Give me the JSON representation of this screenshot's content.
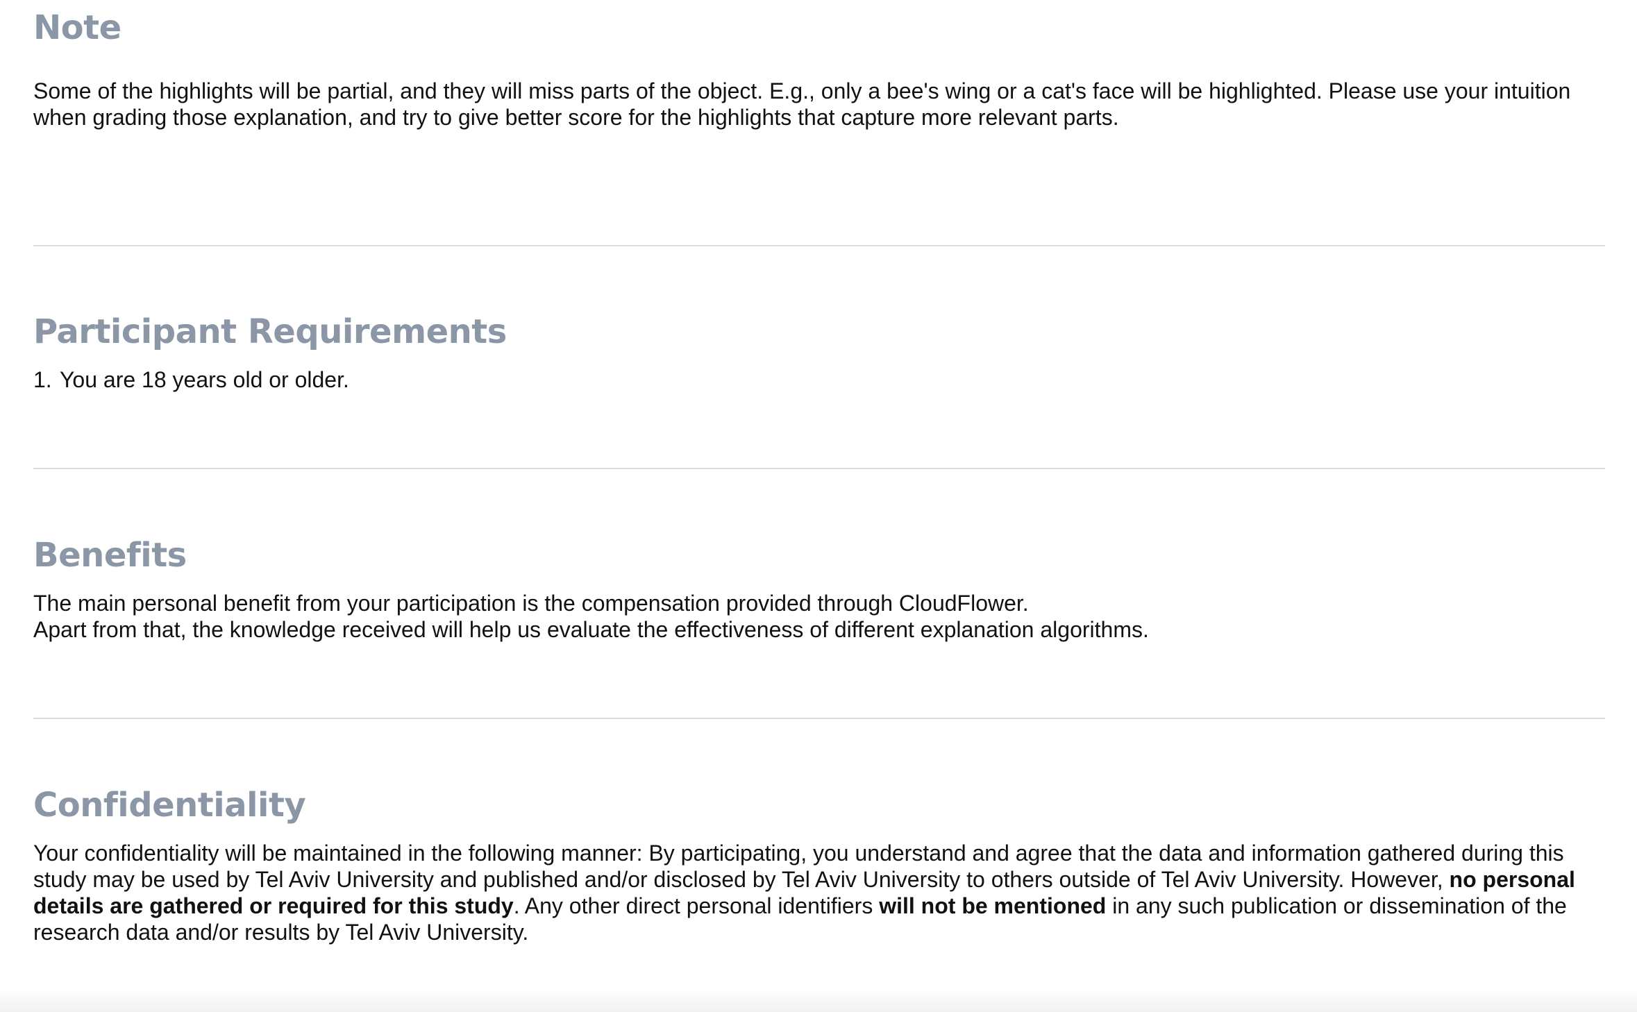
{
  "note": {
    "title": "Note",
    "text": "Some of the highlights will be partial,  and they will miss parts of the object. E.g., only a bee's wing or a cat's face will be highlighted. Please use your intuition when grading those explanation, and try to give better score for the highlights that capture more relevant parts."
  },
  "requirements": {
    "title": "Participant Requirements",
    "items": [
      {
        "number": "1.",
        "text": "You are 18 years old or older."
      }
    ]
  },
  "benefits": {
    "title": "Benefits",
    "line1": "The main personal benefit from your participation is the compensation provided through CloudFlower.",
    "line2": "Apart from that, the knowledge received will help us evaluate the effectiveness of different explanation algorithms."
  },
  "confidentiality": {
    "title": "Confidentiality",
    "text_part1": "Your confidentiality will be maintained in the following manner: By participating, you understand and agree that the data and information gathered during this study may be used by Tel Aviv University and published and/or disclosed by Tel Aviv University to others outside of Tel Aviv University. However, ",
    "bold1": "no personal details are gathered or required for this study",
    "text_part2": ".  Any other direct personal identifiers ",
    "bold2": "will not be mentioned",
    "text_part3": " in any such publication or dissemination of the research data and/or results by Tel Aviv University."
  }
}
